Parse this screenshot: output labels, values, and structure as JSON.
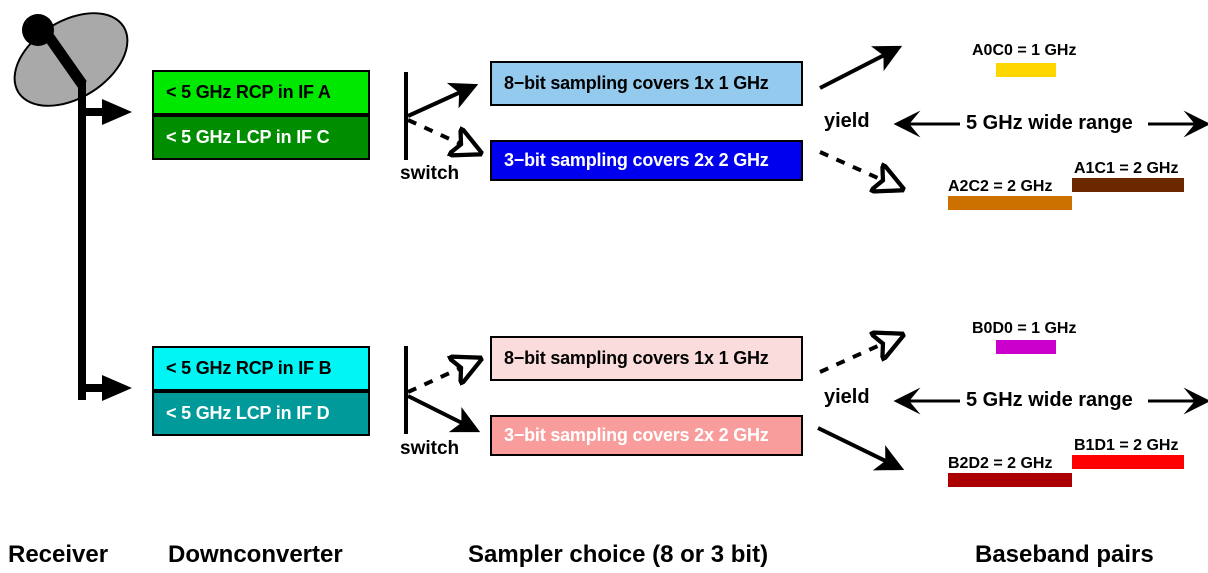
{
  "stages": {
    "receiver": {
      "footer_label": "Receiver",
      "icon": "satellite-dish-icon"
    },
    "downconverter": {
      "footer_label": "Downconverter",
      "chains": [
        {
          "id": "chain-a-c",
          "rcp": {
            "text": "< 5 GHz RCP in IF A",
            "bg": "#00e800",
            "fg": "#000000"
          },
          "lcp": {
            "text": "< 5 GHz LCP in IF C",
            "bg": "#008e00",
            "fg": "#ffffff"
          },
          "switch_label": "switch"
        },
        {
          "id": "chain-b-d",
          "rcp": {
            "text": "< 5 GHz RCP in IF B",
            "bg": "#00f5f5",
            "fg": "#000000"
          },
          "lcp": {
            "text": "< 5 GHz LCP in IF D",
            "bg": "#009a9a",
            "fg": "#ffffff"
          },
          "switch_label": "switch"
        }
      ]
    },
    "sampler": {
      "footer_label": "Sampler choice (8 or 3 bit)",
      "groups": [
        {
          "id": "sampler-top",
          "eight_bit": {
            "text": "8−bit sampling covers 1x 1 GHz",
            "bg": "#93caee",
            "fg": "#000000"
          },
          "three_bit": {
            "text": "3−bit sampling covers 2x 2 GHz",
            "bg": "#0000ee",
            "fg": "#ffffff"
          }
        },
        {
          "id": "sampler-bottom",
          "eight_bit": {
            "text": "8−bit sampling covers 1x 1 GHz",
            "bg": "#fbdcdc",
            "fg": "#000000"
          },
          "three_bit": {
            "text": "3−bit sampling covers 2x 2 GHz",
            "bg": "#f99c9c",
            "fg": "#ffffff"
          }
        }
      ]
    },
    "baseband": {
      "footer_label": "Baseband pairs",
      "groups": [
        {
          "id": "baseband-top",
          "yield_label": "yield",
          "range_label": "5 GHz wide range",
          "narrow": {
            "label": "A0C0 = 1 GHz",
            "color": "#ffd700"
          },
          "wide_left": {
            "label": "A2C2 = 2 GHz",
            "color": "#cc7000"
          },
          "wide_right": {
            "label": "A1C1 = 2 GHz",
            "color": "#6b2800"
          }
        },
        {
          "id": "baseband-bottom",
          "yield_label": "yield",
          "range_label": "5 GHz wide range",
          "narrow": {
            "label": "B0D0 = 1 GHz",
            "color": "#cc00cc"
          },
          "wide_left": {
            "label": "B2D2 = 2 GHz",
            "color": "#aa0000"
          },
          "wide_right": {
            "label": "B1D1 = 2 GHz",
            "color": "#ff0000"
          }
        }
      ]
    }
  }
}
